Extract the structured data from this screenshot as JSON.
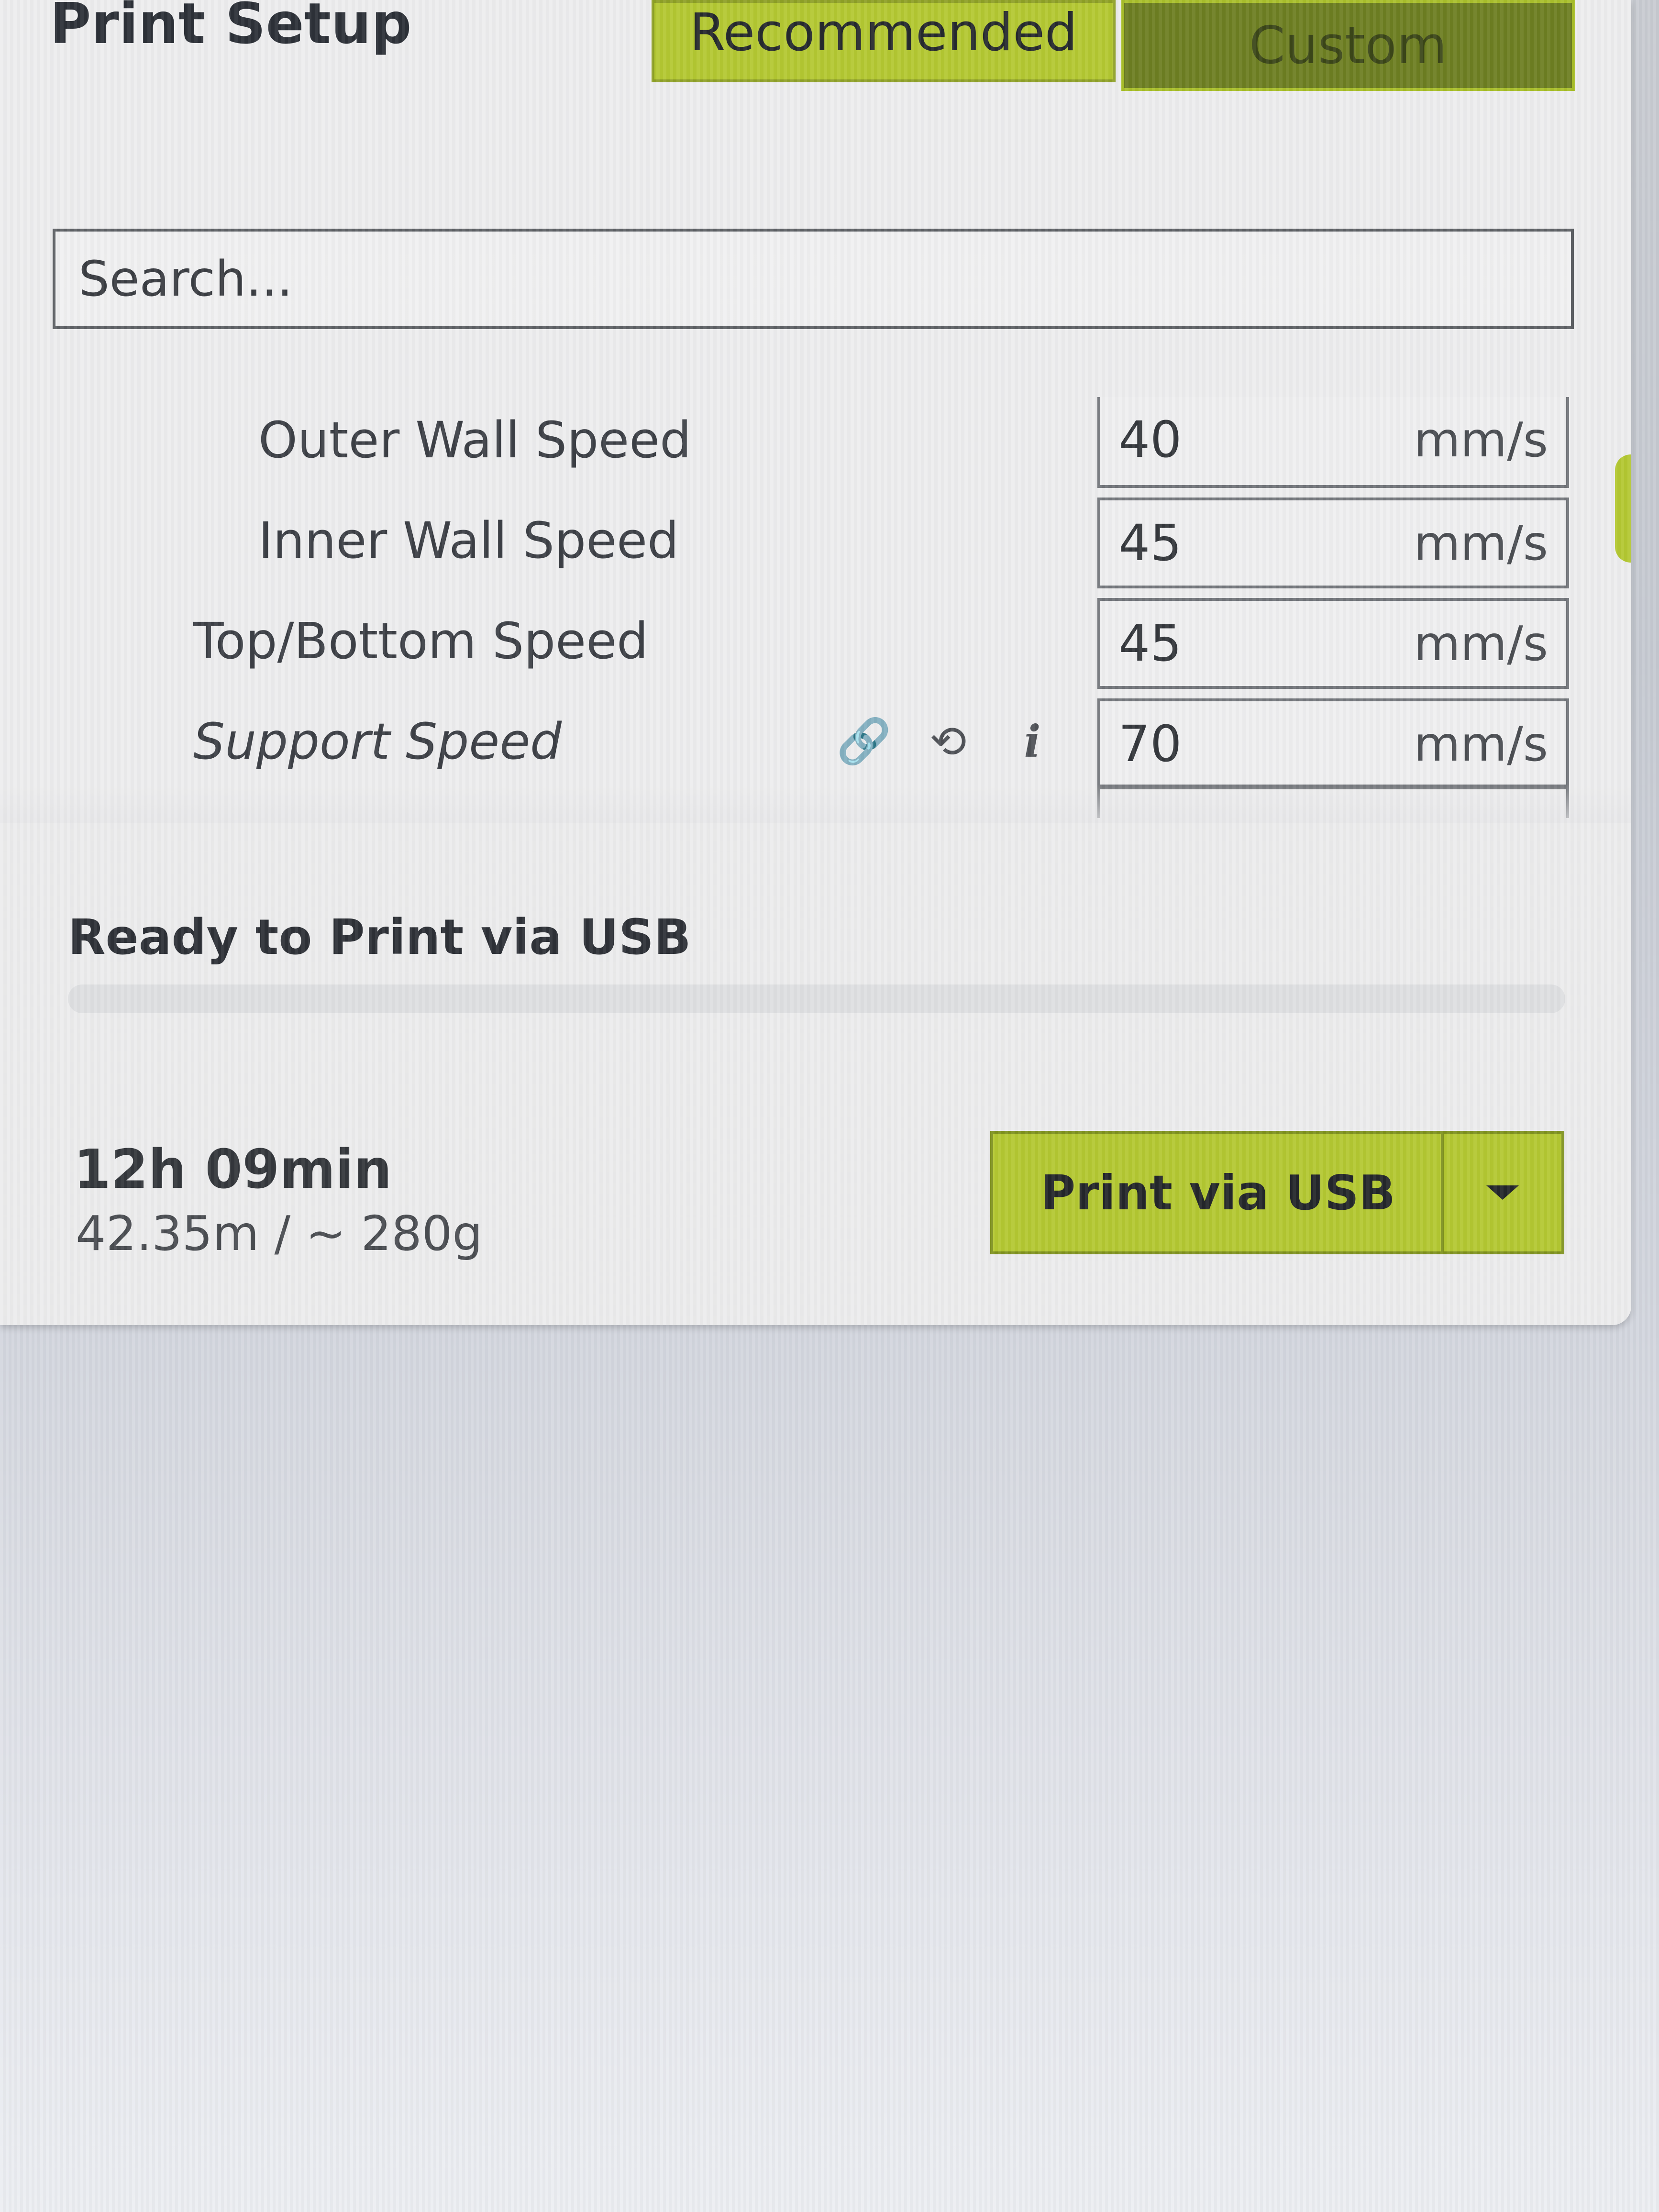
{
  "panel": {
    "title": "Print Setup"
  },
  "tabs": [
    {
      "label": "Recommended",
      "active": false
    },
    {
      "label": "Custom",
      "active": true
    }
  ],
  "search": {
    "placeholder": "Search..."
  },
  "settings": [
    {
      "label": "Outer Wall Speed",
      "value": "40",
      "unit": "mm/s"
    },
    {
      "label": "Inner Wall Speed",
      "value": "45",
      "unit": "mm/s"
    },
    {
      "label": "Top/Bottom Speed",
      "value": "45",
      "unit": "mm/s"
    },
    {
      "label": "Support Speed",
      "value": "70",
      "unit": "mm/s",
      "icons": [
        "link-icon",
        "reset-icon",
        "info-icon"
      ]
    }
  ],
  "icons": {
    "link": "🔗",
    "reset": "⟲",
    "info": "i"
  },
  "status": {
    "text": "Ready to Print via USB",
    "progress_percent": 0
  },
  "estimate": {
    "time": "12h 09min",
    "material": "42.35m / ~ 280g"
  },
  "print_button": {
    "label": "Print via USB"
  },
  "colors": {
    "accent": "#b4c832",
    "accent_dark": "#6d7e22",
    "panel_bg": "#ededee"
  }
}
